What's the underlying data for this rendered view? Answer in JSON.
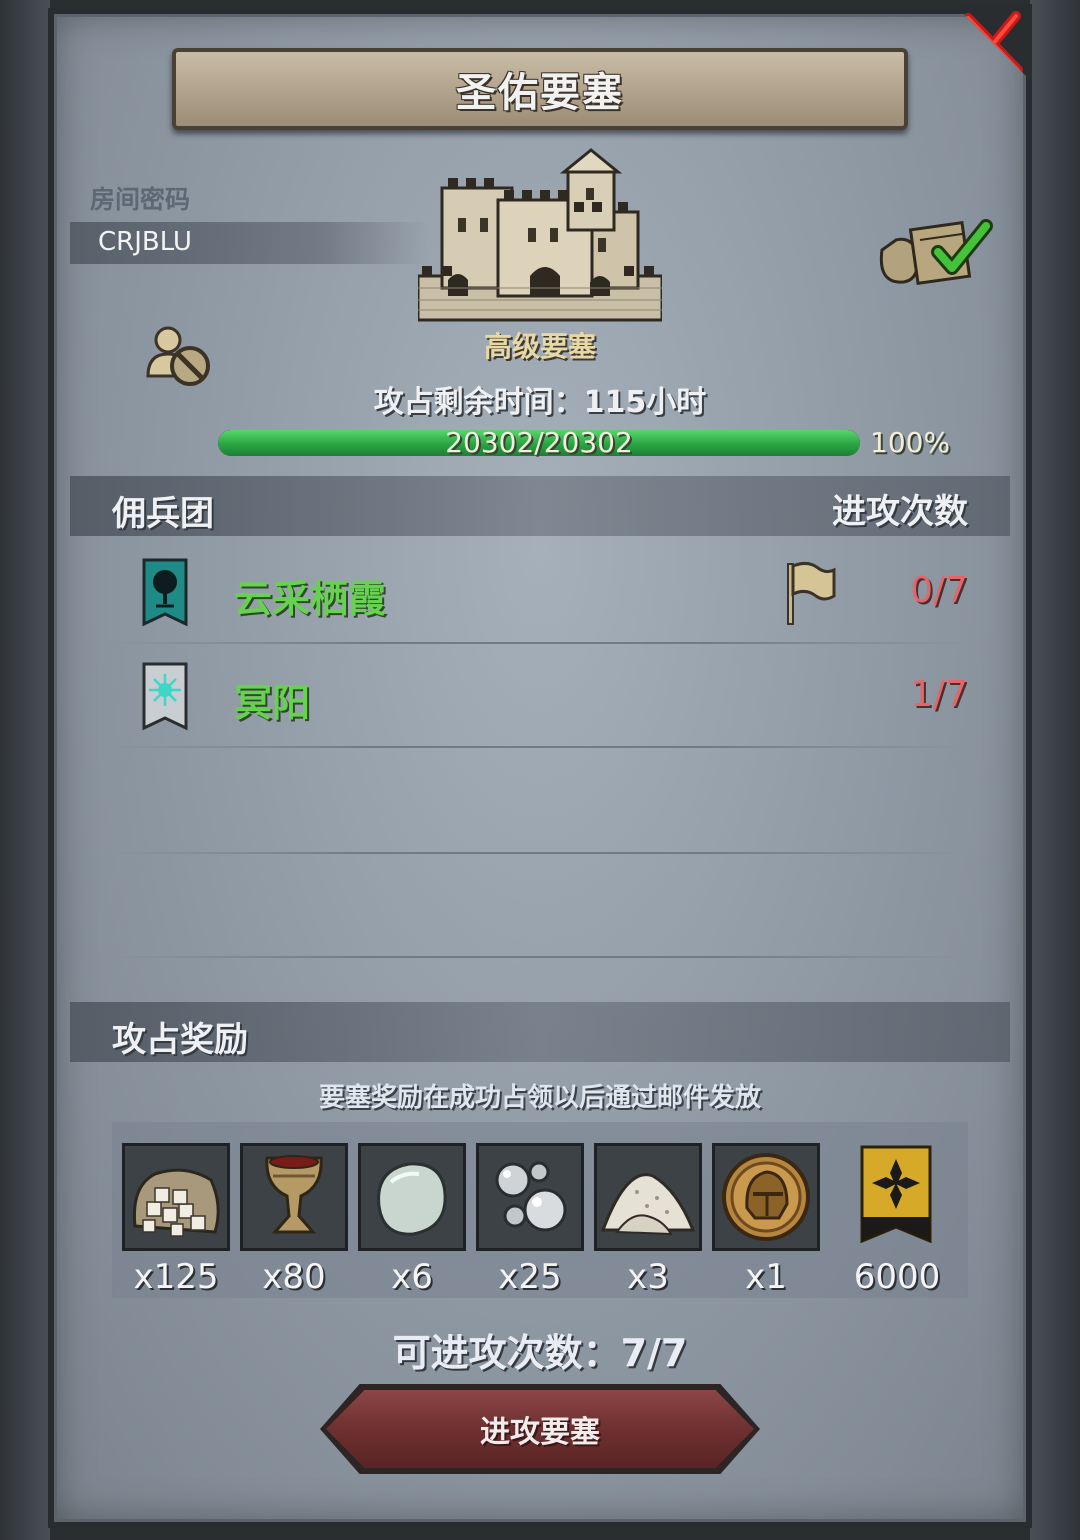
{
  "title": "圣佑要塞",
  "room_password": {
    "label": "房间密码",
    "value": "CRJBLU"
  },
  "fortress": {
    "level": "高级要塞",
    "time_label": "攻占剩余时间：115小时",
    "hp_text": "20302/20302",
    "hp_percent_text": "100%",
    "hp_fraction": 1.0
  },
  "mercenary_section": {
    "title": "佣兵团",
    "attacks_header": "进攻次数",
    "rows": [
      {
        "name": "云采栖霞",
        "count": "0/7",
        "banner_color": "#1f8a86",
        "emblem": "tree-icon"
      },
      {
        "name": "冥阳",
        "count": "1/7",
        "banner_color": "#c9ced3",
        "emblem": "star-icon"
      }
    ]
  },
  "rewards_section": {
    "title": "攻占奖励",
    "note": "要塞奖励在成功占领以后通过邮件发放",
    "items": [
      {
        "icon": "sugar-sack-icon",
        "qty": "x125"
      },
      {
        "icon": "goblet-icon",
        "qty": "x80"
      },
      {
        "icon": "stone-icon",
        "qty": "x6"
      },
      {
        "icon": "silver-pearls-icon",
        "qty": "x25"
      },
      {
        "icon": "salt-pile-icon",
        "qty": "x3"
      },
      {
        "icon": "helmet-coin-icon",
        "qty": "x1"
      },
      {
        "icon": "honor-banner-icon",
        "qty": "6000"
      }
    ]
  },
  "attack_count": "可进攻次数：7/7",
  "attack_button": "进攻要塞"
}
